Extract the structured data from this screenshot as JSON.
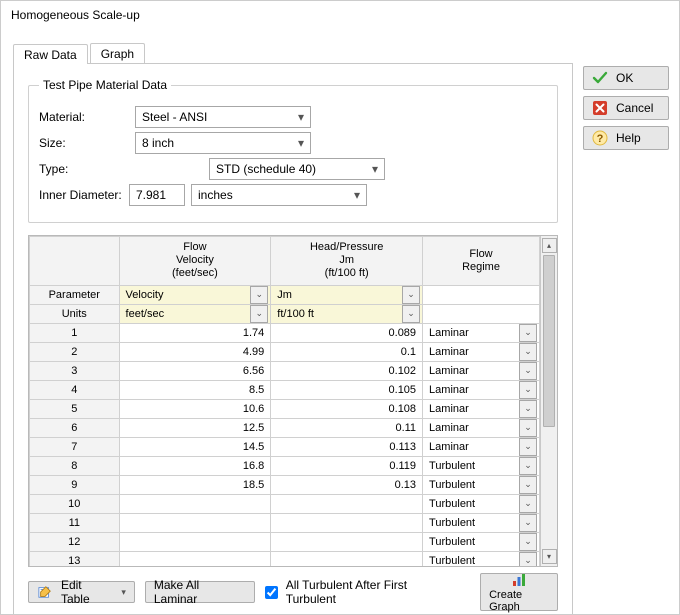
{
  "window": {
    "title": "Homogeneous Scale-up"
  },
  "tabs": {
    "raw": "Raw Data",
    "graph": "Graph"
  },
  "group": {
    "legend": "Test Pipe Material Data",
    "material_label": "Material:",
    "material_value": "Steel - ANSI",
    "size_label": "Size:",
    "size_value": "8 inch",
    "type_label": "Type:",
    "type_value": "STD (schedule 40)",
    "id_label": "Inner Diameter:",
    "id_value": "7.981",
    "id_units": "inches"
  },
  "grid": {
    "headers": {
      "blank": "",
      "flow": "Flow\nVelocity\n(feet/sec)",
      "head": "Head/Pressure\nJm\n(ft/100 ft)",
      "regime": "Flow\nRegime"
    },
    "paramrow": {
      "label": "Parameter",
      "flow": "Velocity",
      "head": "Jm"
    },
    "unitsrow": {
      "label": "Units",
      "flow": "feet/sec",
      "head": "ft/100 ft"
    },
    "rows": [
      {
        "n": "1",
        "flow": "1.74",
        "head": "0.089",
        "regime": "Laminar"
      },
      {
        "n": "2",
        "flow": "4.99",
        "head": "0.1",
        "regime": "Laminar"
      },
      {
        "n": "3",
        "flow": "6.56",
        "head": "0.102",
        "regime": "Laminar"
      },
      {
        "n": "4",
        "flow": "8.5",
        "head": "0.105",
        "regime": "Laminar"
      },
      {
        "n": "5",
        "flow": "10.6",
        "head": "0.108",
        "regime": "Laminar"
      },
      {
        "n": "6",
        "flow": "12.5",
        "head": "0.11",
        "regime": "Laminar"
      },
      {
        "n": "7",
        "flow": "14.5",
        "head": "0.113",
        "regime": "Laminar"
      },
      {
        "n": "8",
        "flow": "16.8",
        "head": "0.119",
        "regime": "Turbulent"
      },
      {
        "n": "9",
        "flow": "18.5",
        "head": "0.13",
        "regime": "Turbulent"
      },
      {
        "n": "10",
        "flow": "",
        "head": "",
        "regime": "Turbulent"
      },
      {
        "n": "11",
        "flow": "",
        "head": "",
        "regime": "Turbulent"
      },
      {
        "n": "12",
        "flow": "",
        "head": "",
        "regime": "Turbulent"
      },
      {
        "n": "13",
        "flow": "",
        "head": "",
        "regime": "Turbulent"
      }
    ]
  },
  "bottom": {
    "edit_table": "Edit Table",
    "make_all_laminar": "Make All Laminar",
    "all_turbulent_checkbox": "All Turbulent After First Turbulent",
    "create_graph": "Create Graph"
  },
  "side": {
    "ok": "OK",
    "cancel": "Cancel",
    "help": "Help"
  },
  "colors": {
    "ok": "#3aa93a",
    "cancel": "#d43d2a",
    "help": "#e7b73b"
  }
}
